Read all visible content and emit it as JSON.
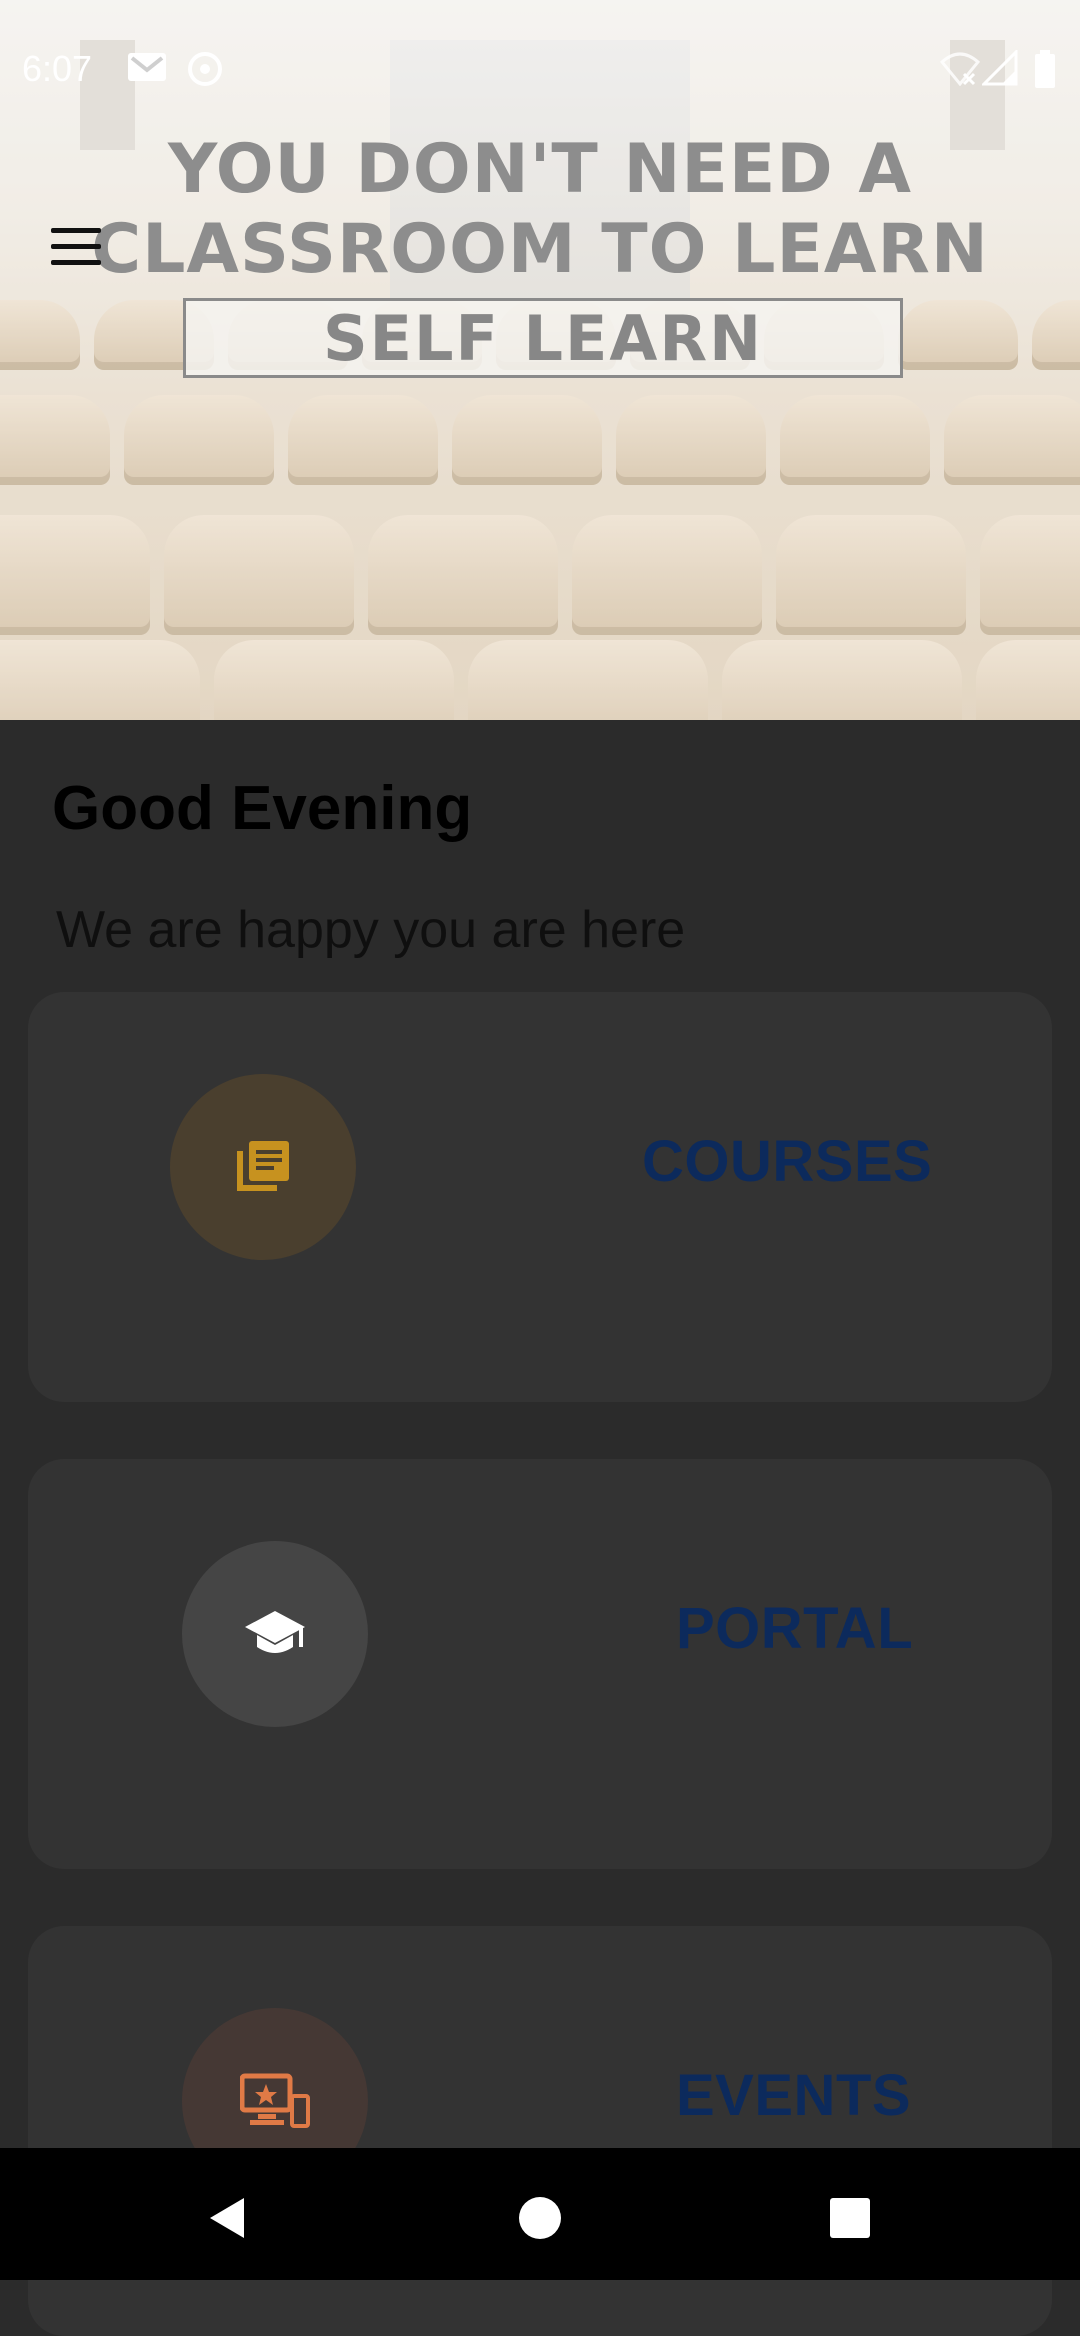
{
  "status_bar": {
    "time": "6:07",
    "icons": [
      "gmail-icon",
      "sync-icon",
      "wifi-icon",
      "signal-icon",
      "battery-icon"
    ]
  },
  "hero": {
    "line1": "YOU DON'T NEED A",
    "line2": "CLASSROOM TO LEARN",
    "badge": "SELF LEARN",
    "menu_icon": "hamburger-menu-icon"
  },
  "greeting": {
    "title": "Good Evening",
    "subtitle": "We are happy you are here"
  },
  "cards": [
    {
      "label": "COURSES",
      "icon": "library-books-icon",
      "icon_color": "#c7921f",
      "circle_color": "#4a3f2e"
    },
    {
      "label": "PORTAL",
      "icon": "graduation-cap-icon",
      "icon_color": "#ffffff",
      "circle_color": "#454545"
    },
    {
      "label": "EVENTS",
      "icon": "devices-star-icon",
      "icon_color": "#e07a46",
      "circle_color": "#453834"
    }
  ],
  "colors": {
    "background": "#2b2b2b",
    "card": "#333333",
    "card_label": "#0c2a5c"
  },
  "nav_bar": {
    "icons": [
      "back-icon",
      "home-icon",
      "recents-icon"
    ]
  }
}
